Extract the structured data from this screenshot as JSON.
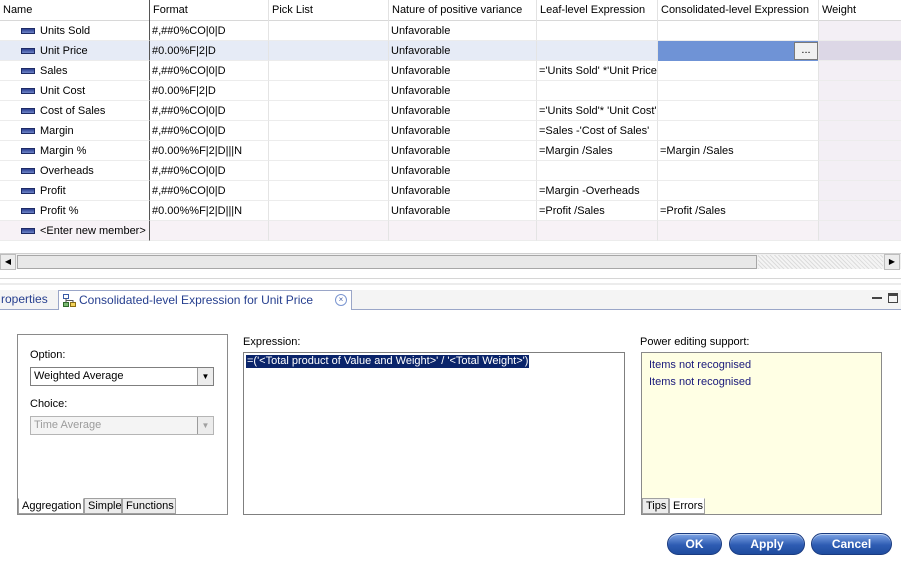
{
  "grid": {
    "columns": [
      "Name",
      "Format",
      "Pick List",
      "Nature of positive variance",
      "Leaf-level Expression",
      "Consolidated-level Expression",
      "Weight"
    ],
    "rows": [
      {
        "name": "Units Sold",
        "format": "#,##0%CO|0|D",
        "pick_list": "",
        "nature": "Unfavorable",
        "leaf": "",
        "consolidated": ""
      },
      {
        "name": "Unit Price",
        "format": "#0.00%F|2|D",
        "pick_list": "",
        "nature": "Unfavorable",
        "leaf": "",
        "consolidated": ""
      },
      {
        "name": "Sales",
        "format": "#,##0%CO|0|D",
        "pick_list": "",
        "nature": "Unfavorable",
        "leaf": "='Units Sold' *'Unit Price'",
        "consolidated": ""
      },
      {
        "name": "Unit Cost",
        "format": "#0.00%F|2|D",
        "pick_list": "",
        "nature": "Unfavorable",
        "leaf": "",
        "consolidated": ""
      },
      {
        "name": "Cost of Sales",
        "format": "#,##0%CO|0|D",
        "pick_list": "",
        "nature": "Unfavorable",
        "leaf": "='Units Sold'* 'Unit Cost'",
        "consolidated": ""
      },
      {
        "name": "Margin",
        "format": "#,##0%CO|0|D",
        "pick_list": "",
        "nature": "Unfavorable",
        "leaf": "=Sales -'Cost of Sales'",
        "consolidated": ""
      },
      {
        "name": "Margin %",
        "format": "#0.00%%F|2|D|||N",
        "pick_list": "",
        "nature": "Unfavorable",
        "leaf": "=Margin /Sales",
        "consolidated": "=Margin /Sales"
      },
      {
        "name": "Overheads",
        "format": "#,##0%CO|0|D",
        "pick_list": "",
        "nature": "Unfavorable",
        "leaf": "",
        "consolidated": ""
      },
      {
        "name": "Profit",
        "format": "#,##0%CO|0|D",
        "pick_list": "",
        "nature": "Unfavorable",
        "leaf": "=Margin -Overheads",
        "consolidated": ""
      },
      {
        "name": "Profit %",
        "format": "#0.00%%F|2|D|||N",
        "pick_list": "",
        "nature": "Unfavorable",
        "leaf": "=Profit /Sales",
        "consolidated": "=Profit /Sales"
      }
    ],
    "new_member_label": "<Enter new member>",
    "edit_button_label": "..."
  },
  "tabs": {
    "properties_label": "roperties",
    "active_label": "Consolidated-level Expression for Unit Price",
    "close_glyph": "×"
  },
  "editor": {
    "option_label": "Option:",
    "option_value": "Weighted Average",
    "choice_label": "Choice:",
    "choice_value": "Time Average",
    "subtabs": [
      "Aggregation",
      "Simple",
      "Functions"
    ],
    "expression_label": "Expression:",
    "expression_value": "=('<Total product of Value and Weight>' / '<Total Weight>')",
    "power_label": "Power editing support:",
    "power_messages": [
      "Items not recognised",
      "Items not recognised"
    ],
    "power_tabs": [
      "Tips",
      "Errors"
    ]
  },
  "buttons": {
    "ok": "OK",
    "apply": "Apply",
    "cancel": "Cancel"
  },
  "icons": {
    "member": "member-bar-icon",
    "tab": "expression-tree-icon",
    "close": "close-icon",
    "dropdown": "chevron-down-icon"
  },
  "colors": {
    "selection_row": "#e6ebf6",
    "edit_cell": "#6f93d6",
    "tab_text": "#263f8f",
    "button": "#2e5cb3",
    "power_bg": "#ffffe4",
    "expression_highlight": "#0a246a"
  }
}
